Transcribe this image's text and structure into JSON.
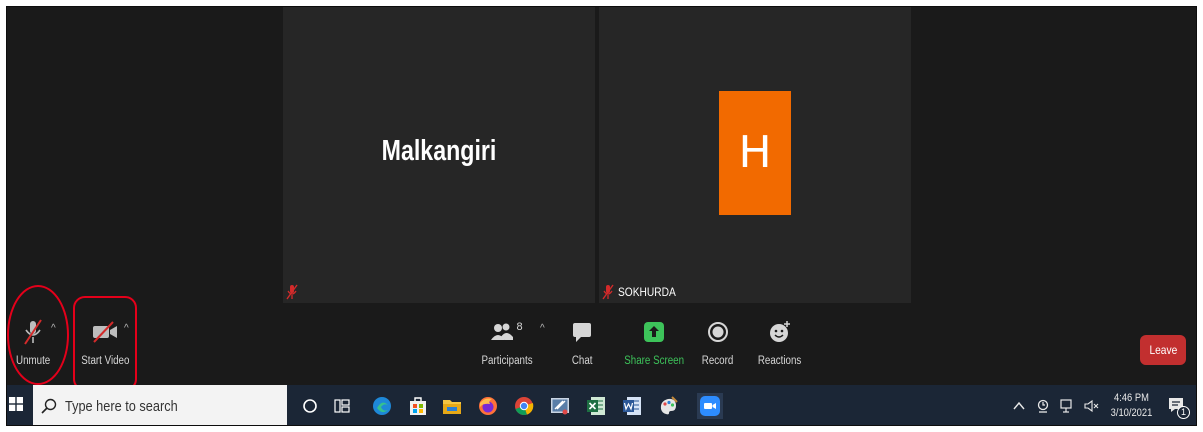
{
  "meeting": {
    "tiles": [
      {
        "name": "Malkangiri",
        "footer_name": ""
      },
      {
        "avatar_letter": "H",
        "footer_name": "SOKHURDA",
        "avatar_color": "#f26a00"
      }
    ]
  },
  "toolbar": {
    "unmute_label": "Unmute",
    "start_video_label": "Start Video",
    "participants_label": "Participants",
    "participants_count": "8",
    "chat_label": "Chat",
    "share_screen_label": "Share Screen",
    "record_label": "Record",
    "reactions_label": "Reactions",
    "leave_label": "Leave",
    "share_color": "#3dc35a",
    "leave_color": "#c22f2f",
    "highlight_color": "#e4001a"
  },
  "taskbar": {
    "search_placeholder": "Type here to search",
    "clock_time": "4:46 PM",
    "clock_date": "3/10/2021",
    "notification_count": "1",
    "pinned_icons": [
      "cortana-icon",
      "task-view-icon",
      "edge-icon",
      "store-icon",
      "file-explorer-icon",
      "firefox-icon",
      "chrome-icon",
      "snipping-tool-icon",
      "excel-icon",
      "word-icon",
      "paint-icon",
      "zoom-icon"
    ]
  }
}
